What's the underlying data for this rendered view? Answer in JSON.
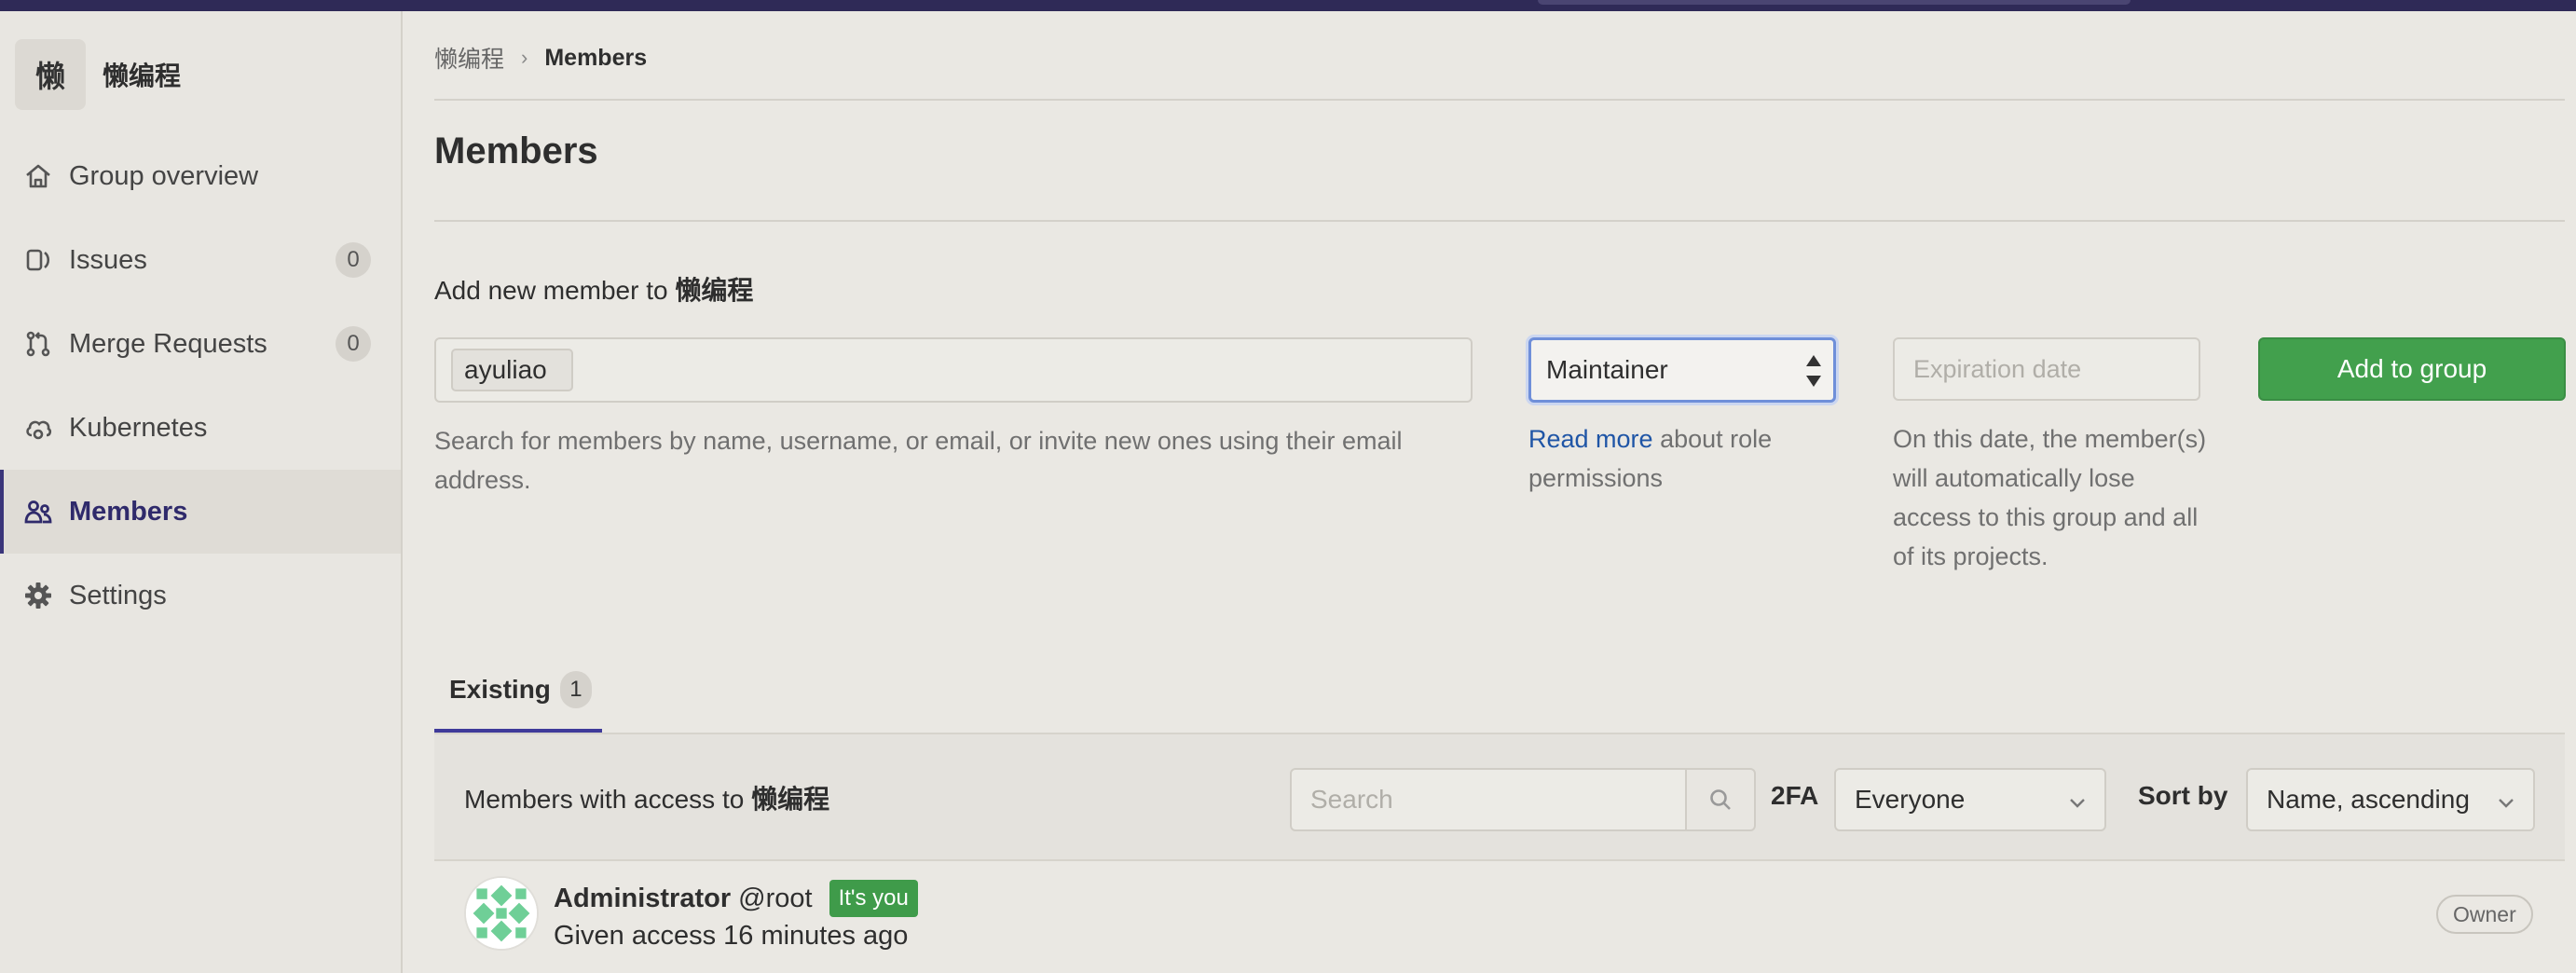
{
  "group": {
    "avatar_letter": "懒",
    "name": "懒编程"
  },
  "sidebar": {
    "items": [
      {
        "label": "Group overview",
        "icon": "home-icon"
      },
      {
        "label": "Issues",
        "icon": "issues-icon",
        "badge": "0"
      },
      {
        "label": "Merge Requests",
        "icon": "merge-request-icon",
        "badge": "0"
      },
      {
        "label": "Kubernetes",
        "icon": "cloud-gear-icon"
      },
      {
        "label": "Members",
        "icon": "users-icon",
        "active": true
      },
      {
        "label": "Settings",
        "icon": "gear-icon"
      }
    ]
  },
  "breadcrumb": {
    "group": "懒编程",
    "separator": "›",
    "current": "Members"
  },
  "page": {
    "title": "Members"
  },
  "add_member": {
    "title_prefix": "Add new member to ",
    "title_group": "懒编程",
    "token_value": "ayuliao",
    "help_text": "Search for members by name, username, or email, or invite new ones using their email address.",
    "role_value": "Maintainer",
    "role_help_link": "Read more",
    "role_help_rest": " about role permissions",
    "expiration_placeholder": "Expiration date",
    "expiration_help": "On this date, the member(s) will automatically lose access to this group and all of its projects.",
    "add_button": "Add to group"
  },
  "tabs": {
    "existing_label": "Existing",
    "existing_count": "1"
  },
  "members_panel": {
    "title_prefix": "Members with access to ",
    "title_group": "懒编程",
    "search_placeholder": "Search",
    "twofa_label": "2FA",
    "twofa_value": "Everyone",
    "sort_label": "Sort by",
    "sort_value": "Name, ascending"
  },
  "members": [
    {
      "name": "Administrator",
      "username": "@root",
      "badge": "It's you",
      "access": "Given access 16 minutes ago",
      "role": "Owner"
    }
  ],
  "colors": {
    "topbar": "#2f2a57",
    "accent": "#3f3a9a",
    "primary_button": "#42a04d",
    "link": "#1f55a6"
  }
}
